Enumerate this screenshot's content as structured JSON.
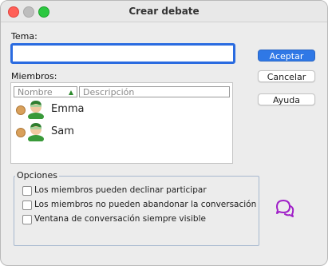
{
  "window": {
    "title": "Crear debate"
  },
  "form": {
    "tema_label": "Tema:",
    "tema_value": "",
    "miembros_label": "Miembros:"
  },
  "members_table": {
    "columns": [
      "Nombre",
      "Descripción"
    ],
    "rows": [
      {
        "name": "Emma",
        "status_color": "#d9a05b"
      },
      {
        "name": "Sam",
        "status_color": "#d9a05b"
      }
    ]
  },
  "options": {
    "title": "Opciones",
    "items": [
      {
        "label": "Los miembros pueden declinar participar",
        "checked": false
      },
      {
        "label": "Los miembros no pueden abandonar la conversación",
        "checked": false
      },
      {
        "label": "Ventana de conversación siempre visible",
        "checked": false
      }
    ]
  },
  "buttons": {
    "accept": "Aceptar",
    "cancel": "Cancelar",
    "help": "Ayuda"
  },
  "colors": {
    "accent": "#2f78e6",
    "chat_icon": "#a020c8"
  }
}
